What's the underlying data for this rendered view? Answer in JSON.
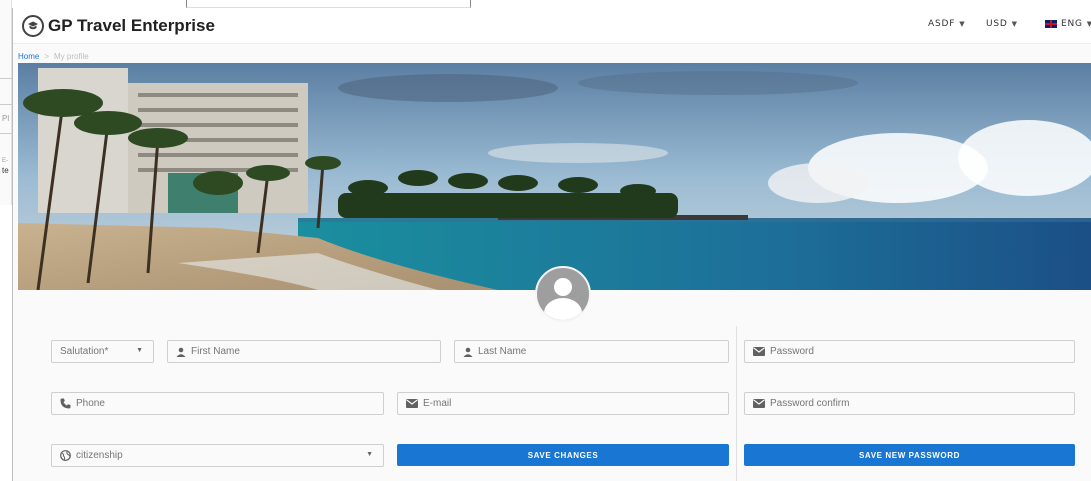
{
  "background": {
    "fragment_1": "Pl",
    "fragment_2": "E-",
    "fragment_3": "te"
  },
  "header": {
    "brand": "GP Travel Enterprise",
    "menus": [
      {
        "label": "ASDF"
      },
      {
        "label": "USD"
      },
      {
        "label": "ENG"
      }
    ]
  },
  "breadcrumb": {
    "home": "Home",
    "separator": ">",
    "current": "My profile"
  },
  "form": {
    "salutation": {
      "placeholder": "Salutation*"
    },
    "first_name": {
      "placeholder": "First Name"
    },
    "last_name": {
      "placeholder": "Last Name"
    },
    "password": {
      "placeholder": "Password"
    },
    "phone": {
      "placeholder": "Phone"
    },
    "email": {
      "placeholder": "E-mail"
    },
    "password_confirm": {
      "placeholder": "Password confirm"
    },
    "citizenship": {
      "placeholder": "citizenship"
    },
    "save_changes": "SAVE CHANGES",
    "save_new_password": "SAVE NEW PASSWORD"
  },
  "colors": {
    "primary": "#1976d2",
    "brand_text": "#212121"
  }
}
